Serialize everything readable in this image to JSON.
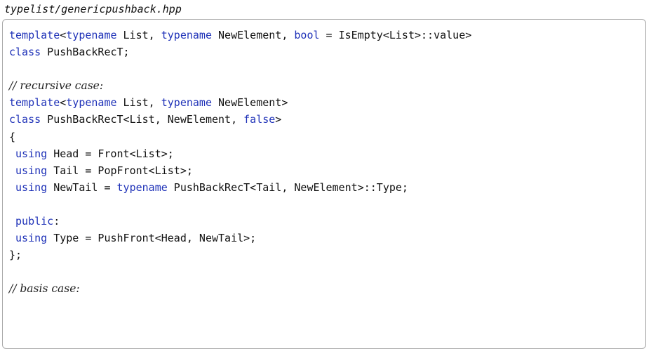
{
  "filename": "typelist/genericpushback.hpp",
  "lines": [
    [
      [
        "kw",
        "template"
      ],
      [
        "",
        "<"
      ],
      [
        "kw",
        "typename"
      ],
      [
        "",
        " List, "
      ],
      [
        "kw",
        "typename"
      ],
      [
        "",
        " NewElement, "
      ],
      [
        "kw",
        "bool"
      ],
      [
        "",
        " = IsEmpty<List>::value>"
      ]
    ],
    [
      [
        "kw",
        "class"
      ],
      [
        "",
        " PushBackRecT;"
      ]
    ],
    [],
    [
      [
        "cm",
        "// recursive case:"
      ]
    ],
    [
      [
        "kw",
        "template"
      ],
      [
        "",
        "<"
      ],
      [
        "kw",
        "typename"
      ],
      [
        "",
        " List, "
      ],
      [
        "kw",
        "typename"
      ],
      [
        "",
        " NewElement>"
      ]
    ],
    [
      [
        "kw",
        "class"
      ],
      [
        "",
        " PushBackRecT<List, NewElement, "
      ],
      [
        "kw",
        "false"
      ],
      [
        "",
        ">"
      ]
    ],
    [
      [
        "",
        "{"
      ]
    ],
    [
      [
        "",
        " "
      ],
      [
        "kw",
        "using"
      ],
      [
        "",
        " Head = Front<List>;"
      ]
    ],
    [
      [
        "",
        " "
      ],
      [
        "kw",
        "using"
      ],
      [
        "",
        " Tail = PopFront<List>;"
      ]
    ],
    [
      [
        "",
        " "
      ],
      [
        "kw",
        "using"
      ],
      [
        "",
        " NewTail = "
      ],
      [
        "kw",
        "typename"
      ],
      [
        "",
        " PushBackRecT<Tail, NewElement>::Type;"
      ]
    ],
    [],
    [
      [
        "",
        " "
      ],
      [
        "kw",
        "public"
      ],
      [
        "",
        ":"
      ]
    ],
    [
      [
        "",
        " "
      ],
      [
        "kw",
        "using"
      ],
      [
        "",
        " Type = PushFront<Head, NewTail>;"
      ]
    ],
    [
      [
        "",
        "};"
      ]
    ],
    [],
    [
      [
        "cm",
        "// basis case:"
      ]
    ]
  ]
}
